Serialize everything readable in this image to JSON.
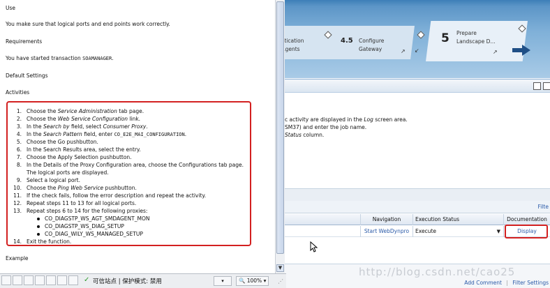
{
  "help": {
    "use_heading": "Use",
    "use_text": "You make sure that logical ports and end points work correctly.",
    "requirements_heading": "Requirements",
    "requirements_text_prefix": "You have started transaction ",
    "requirements_tcode": "SOAMANAGER",
    "requirements_text_suffix": ".",
    "default_heading": "Default Settings",
    "activities_heading": "Activities",
    "example_heading": "Example",
    "steps": [
      {
        "n": "1.",
        "parts": [
          "Choose the ",
          "<i>Service Administration</i>",
          " tab page."
        ]
      },
      {
        "n": "2.",
        "parts": [
          "Choose the ",
          "<i>Web Service Configuration</i>",
          " link."
        ]
      },
      {
        "n": "3.",
        "parts": [
          "In the ",
          "<i>Search by</i>",
          " field, select ",
          "<i>Consumer Proxy</i>",
          "."
        ]
      },
      {
        "n": "4.",
        "parts": [
          "In the ",
          "<i>Search Pattern</i>",
          " field, enter ",
          "<c>CO_E2E_MAI_CONFIGURATION</c>",
          "."
        ]
      },
      {
        "n": "5.",
        "parts": [
          "Choose the Go pushbutton."
        ]
      },
      {
        "n": "6.",
        "parts": [
          "In the Search Results area, select the entry."
        ]
      },
      {
        "n": "7.",
        "parts": [
          "Choose the Apply Selection pushbutton."
        ]
      },
      {
        "n": "8.",
        "parts": [
          "In the Details of the Proxy Configuration area, choose the Configurations tab page."
        ]
      },
      {
        "n": "",
        "parts": [
          "The logical ports are displayed."
        ]
      },
      {
        "n": "9.",
        "parts": [
          "Select a logical port."
        ]
      },
      {
        "n": "10.",
        "parts": [
          "Choose the ",
          "<i>Ping Web Service</i>",
          " pushbutton."
        ]
      },
      {
        "n": "11.",
        "parts": [
          "If the check fails, follow the error description and repeat the activity."
        ]
      },
      {
        "n": "12.",
        "parts": [
          "Repeat steps 11 to 13 for all logical ports."
        ]
      },
      {
        "n": "13.",
        "parts": [
          "Repeat steps 6 to 14 for the following proxies:"
        ]
      }
    ],
    "proxies": [
      "CO_DIAGSTP_WS_AGT_SMDAGENT_MON",
      "CO_DIAGSTP_WS_DIAG_SETUP",
      "CO_DIAG_WILY_WS_MANAGED_SETUP"
    ],
    "last_step": {
      "n": "14.",
      "text": "Exit the function."
    }
  },
  "status_bar": {
    "zone_text": "可信站点 | 保护模式: 禁用",
    "zoom": "100%",
    "check_icon": "check-icon"
  },
  "roadmap": {
    "prev_step_line1": "entication",
    "prev_step_line2": "r Agents",
    "mid_step_number": "4.5",
    "mid_step_line1": "Configure",
    "mid_step_line2": "Gateway",
    "current_step_number": "5",
    "current_step_line1": "Prepare",
    "current_step_line2": "Landscape D..."
  },
  "log": {
    "line1_prefix": "c activity are displayed in the ",
    "line1_italic": "Log",
    "line1_suffix": " screen area.",
    "line2": "SM37) and enter the job name.",
    "line3_italic": "Status",
    "line3_suffix": " column."
  },
  "filter_link": "Filte",
  "grid": {
    "headers": {
      "navigation": "Navigation",
      "execution_status": "Execution Status",
      "documentation": "Documentation"
    },
    "row": {
      "navigation": "Start WebDynpro",
      "execution_status": "Execute",
      "documentation": "Display"
    }
  },
  "bottom": {
    "add_comment": "Add Comment",
    "filter_settings": "Filter Settings",
    "watermark": "http://blog.csdn.net/cao25"
  },
  "colors": {
    "highlight_red": "#d32020",
    "link_blue": "#2a5aa8",
    "roadmap_blue": "#5c95c7"
  }
}
